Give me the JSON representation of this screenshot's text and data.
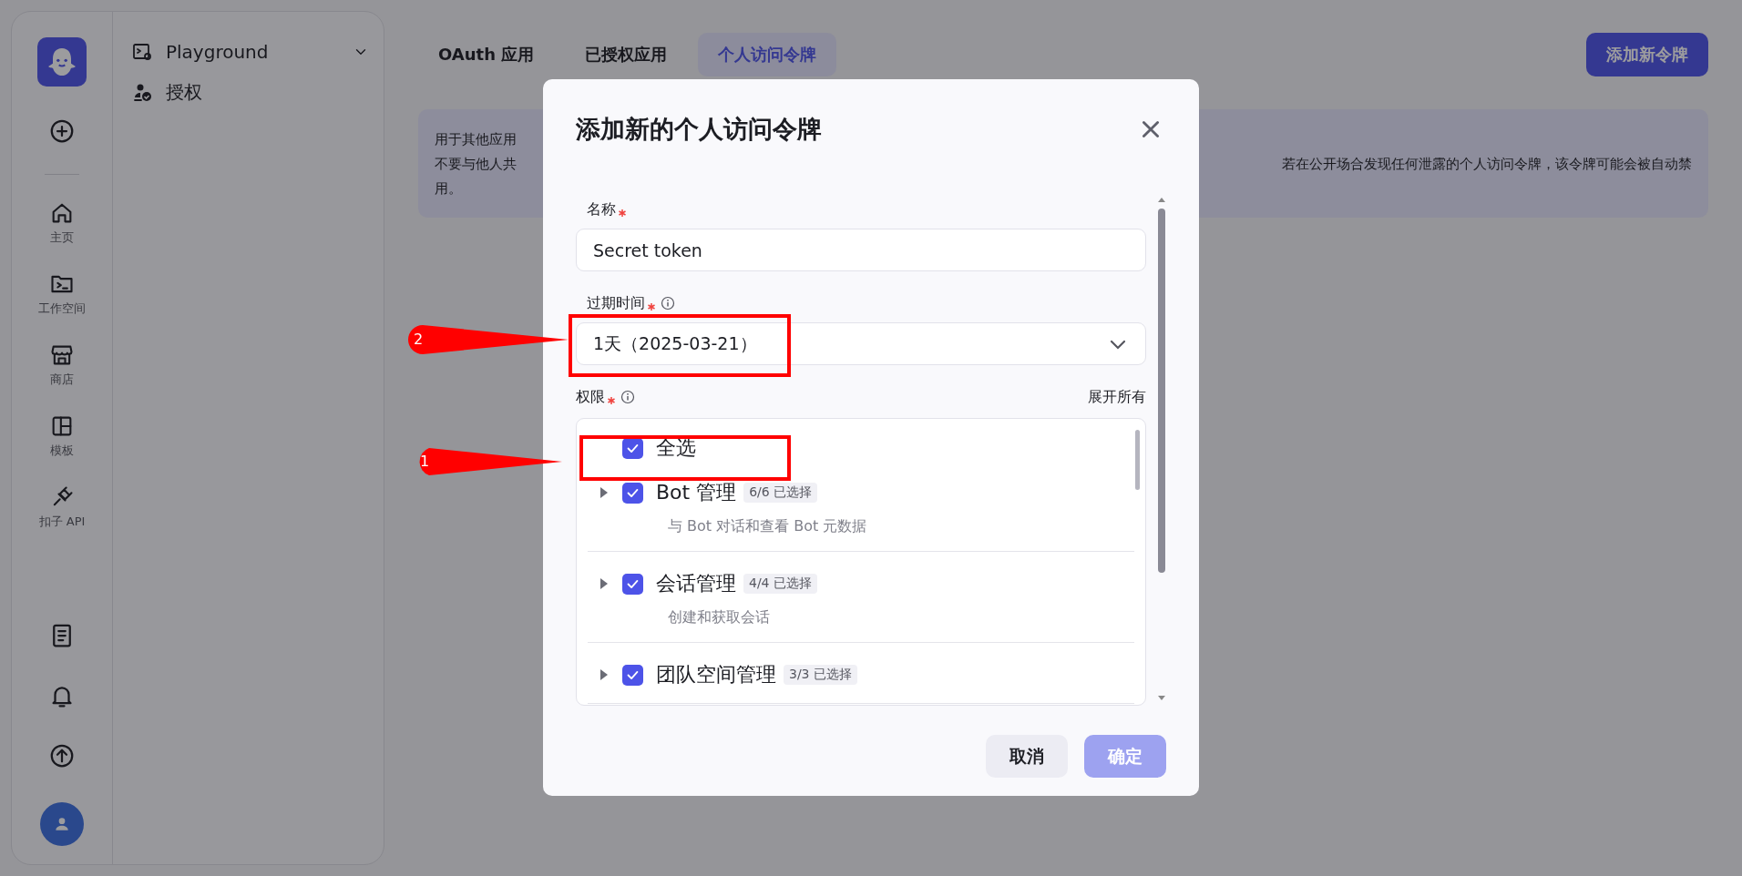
{
  "rail": {
    "items": [
      {
        "label": "主页"
      },
      {
        "label": "工作空间"
      },
      {
        "label": "商店"
      },
      {
        "label": "模板"
      },
      {
        "label": "扣子 API"
      }
    ]
  },
  "nav": {
    "items": [
      {
        "label": "Playground"
      },
      {
        "label": "授权"
      }
    ]
  },
  "tabs": [
    {
      "label": "OAuth 应用",
      "selected": false
    },
    {
      "label": "已授权应用",
      "selected": false
    },
    {
      "label": "个人访问令牌",
      "selected": true
    }
  ],
  "add_button": "添加新令牌",
  "banner": {
    "line_1": "用于其他应用",
    "line_2_start": "不要与他人共",
    "line_2_end": "若在公开场合发现任何泄露的个人访问令牌，该令牌可能会被自动禁",
    "line_3": "用。"
  },
  "dialog": {
    "title": "添加新的个人访问令牌",
    "name_field": {
      "label": "名称",
      "required": true,
      "value": "Secret token"
    },
    "expiry_field": {
      "label": "过期时间",
      "required": true,
      "value": "1天（2025-03-21）"
    },
    "permissions": {
      "label": "权限",
      "required": true,
      "expand_all": "展开所有",
      "select_all": {
        "label": "全选",
        "checked": true
      },
      "items": [
        {
          "name": "Bot 管理",
          "count": "6/6 已选择",
          "description": "与 Bot 对话和查看 Bot 元数据",
          "checked": true,
          "expanded": false
        },
        {
          "name": "会话管理",
          "count": "4/4 已选择",
          "description": "创建和获取会话",
          "checked": true,
          "expanded": false
        },
        {
          "name": "团队空间管理",
          "count": "3/3 已选择",
          "checked": true,
          "expanded": false
        }
      ]
    },
    "buttons": [
      {
        "label": "取消",
        "kind": "secondary",
        "disabled": false
      },
      {
        "label": "确定",
        "kind": "primary",
        "disabled": true
      }
    ]
  },
  "annotations": [
    {
      "label": "1"
    },
    {
      "label": "2"
    }
  ]
}
